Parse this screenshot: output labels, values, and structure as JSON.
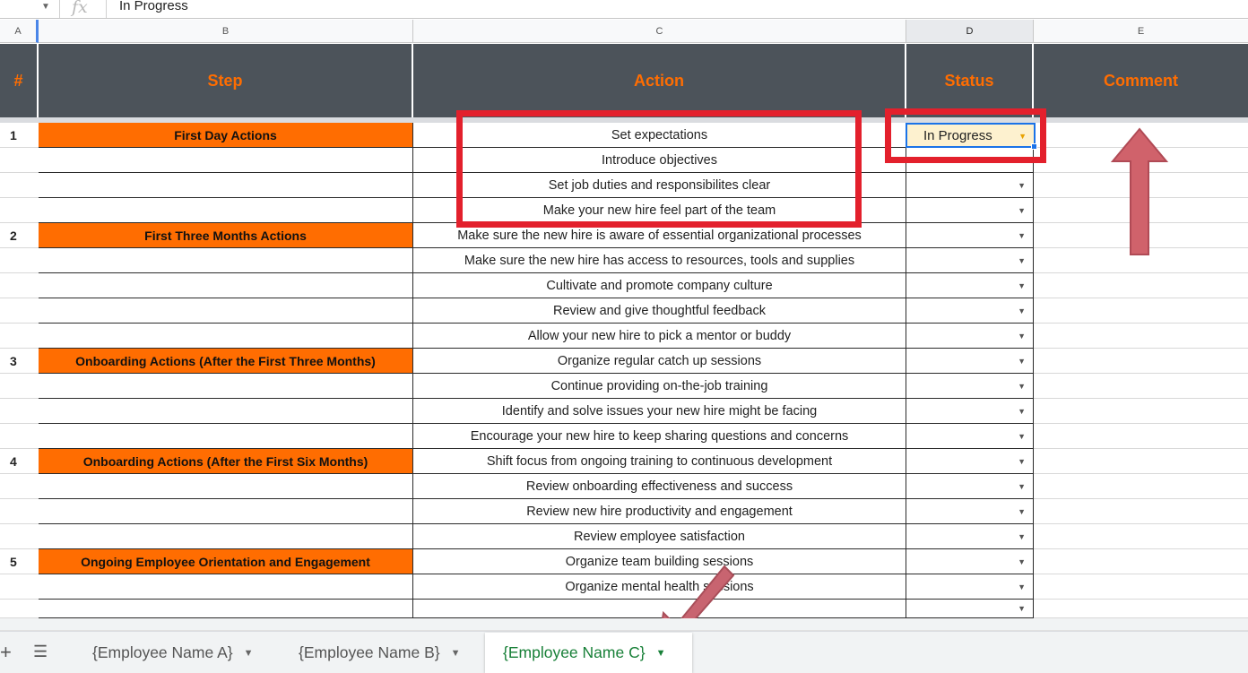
{
  "formula_bar": {
    "value": "In Progress"
  },
  "columns": [
    "A",
    "B",
    "C",
    "D",
    "E"
  ],
  "headers": {
    "num": "#",
    "step": "Step",
    "action": "Action",
    "status": "Status",
    "comment": "Comment"
  },
  "rows": [
    {
      "num": "1",
      "step": "First Day Actions",
      "action": "Set expectations",
      "status": "In Progress"
    },
    {
      "num": "",
      "step": "",
      "action": "Introduce objectives",
      "status": ""
    },
    {
      "num": "",
      "step": "",
      "action": "Set job duties and responsibilites clear",
      "status": ""
    },
    {
      "num": "",
      "step": "",
      "action": "Make your new hire feel part of the team",
      "status": ""
    },
    {
      "num": "2",
      "step": "First Three Months Actions",
      "action": "Make sure the new hire is aware of essential organizational processes",
      "status": ""
    },
    {
      "num": "",
      "step": "",
      "action": "Make sure the new hire has access to resources, tools and supplies",
      "status": ""
    },
    {
      "num": "",
      "step": "",
      "action": "Cultivate and promote company culture",
      "status": ""
    },
    {
      "num": "",
      "step": "",
      "action": "Review and give thoughtful feedback",
      "status": ""
    },
    {
      "num": "",
      "step": "",
      "action": "Allow your new hire to pick a mentor or buddy",
      "status": ""
    },
    {
      "num": "3",
      "step": "Onboarding Actions (After the First Three Months)",
      "action": "Organize regular catch up sessions",
      "status": ""
    },
    {
      "num": "",
      "step": "",
      "action": "Continue providing on-the-job training",
      "status": ""
    },
    {
      "num": "",
      "step": "",
      "action": "Identify and solve issues your new hire might be facing",
      "status": ""
    },
    {
      "num": "",
      "step": "",
      "action": "Encourage your new hire to keep sharing questions and concerns",
      "status": ""
    },
    {
      "num": "4",
      "step": "Onboarding Actions (After the First Six Months)",
      "action": "Shift focus from ongoing training to continuous development",
      "status": ""
    },
    {
      "num": "",
      "step": "",
      "action": "Review onboarding effectiveness and success",
      "status": ""
    },
    {
      "num": "",
      "step": "",
      "action": "Review new hire productivity and engagement",
      "status": ""
    },
    {
      "num": "",
      "step": "",
      "action": "Review employee satisfaction",
      "status": ""
    },
    {
      "num": "5",
      "step": "Ongoing Employee Orientation and Engagement",
      "action": "Organize team building sessions",
      "status": ""
    },
    {
      "num": "",
      "step": "",
      "action": "Organize mental health sessions",
      "status": ""
    },
    {
      "num": "",
      "step": "",
      "action": "",
      "status": ""
    }
  ],
  "sheet_tabs": [
    {
      "label": "{Employee Name A}",
      "active": false
    },
    {
      "label": "{Employee Name B}",
      "active": false
    },
    {
      "label": "{Employee Name C}",
      "active": true
    }
  ],
  "colors": {
    "header_bg": "#4c535a",
    "header_text": "#ff6d01",
    "step_fill": "#ff6d01",
    "highlight": "#e3202c",
    "active_tab_text": "#188038"
  },
  "icons": {
    "dropdown": "triangle-down",
    "add_sheet": "plus",
    "all_sheets": "list-lines",
    "fx": "function-icon"
  }
}
